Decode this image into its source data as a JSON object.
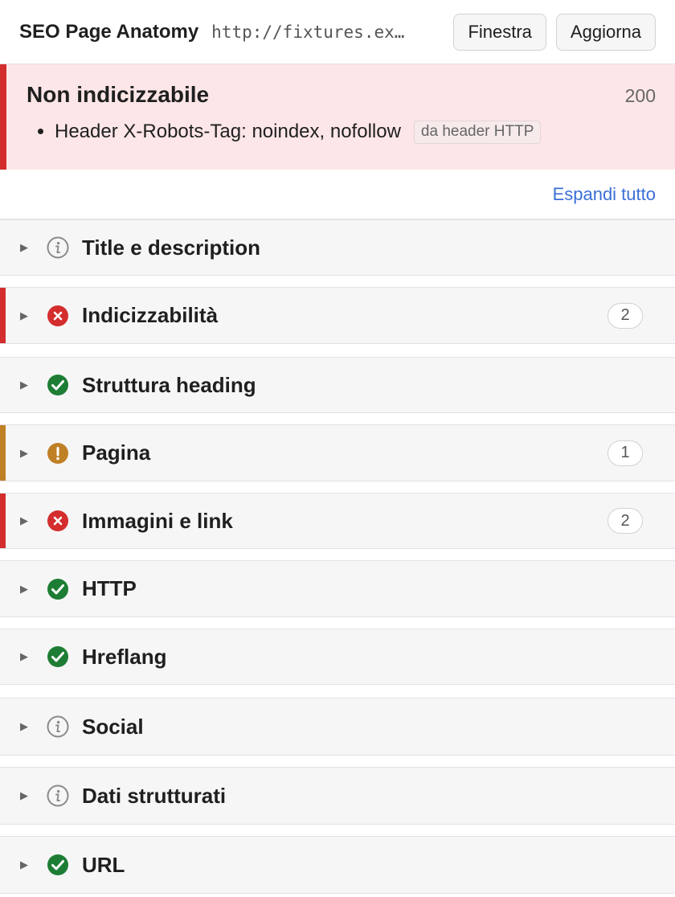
{
  "header": {
    "title": "SEO Page Anatomy",
    "url": "http://fixtures.ex…",
    "window_button": "Finestra",
    "refresh_button": "Aggiorna"
  },
  "banner": {
    "title": "Non indicizzabile",
    "status_code": "200",
    "reasons": [
      {
        "text": "Header X-Robots-Tag: noindex, nofollow",
        "source": "da header HTTP"
      }
    ],
    "accent_color": "#d32d2d"
  },
  "expand_all": "Espandi tutto",
  "sections": [
    {
      "label": "Title e description",
      "status": "info",
      "icon": "info-icon",
      "count": ""
    },
    {
      "label": "Indicizzabilità",
      "status": "error",
      "icon": "error-icon",
      "count": "2"
    },
    {
      "label": "Struttura heading",
      "status": "ok",
      "icon": "check-icon",
      "count": ""
    },
    {
      "label": "Pagina",
      "status": "warning",
      "icon": "warning-icon",
      "count": "1"
    },
    {
      "label": "Immagini e link",
      "status": "error",
      "icon": "error-icon",
      "count": "2"
    },
    {
      "label": "HTTP",
      "status": "ok",
      "icon": "check-icon",
      "count": ""
    },
    {
      "label": "Hreflang",
      "status": "ok",
      "icon": "check-icon",
      "count": ""
    },
    {
      "label": "Social",
      "status": "info",
      "icon": "info-icon",
      "count": ""
    },
    {
      "label": "Dati strutturati",
      "status": "info",
      "icon": "info-icon",
      "count": ""
    },
    {
      "label": "URL",
      "status": "ok",
      "icon": "check-icon",
      "count": ""
    }
  ],
  "colors": {
    "error": "#d32d2d",
    "warning": "#c08026",
    "ok": "#1e7d34",
    "info": "#8a8a8a",
    "link": "#3b6fd6"
  }
}
